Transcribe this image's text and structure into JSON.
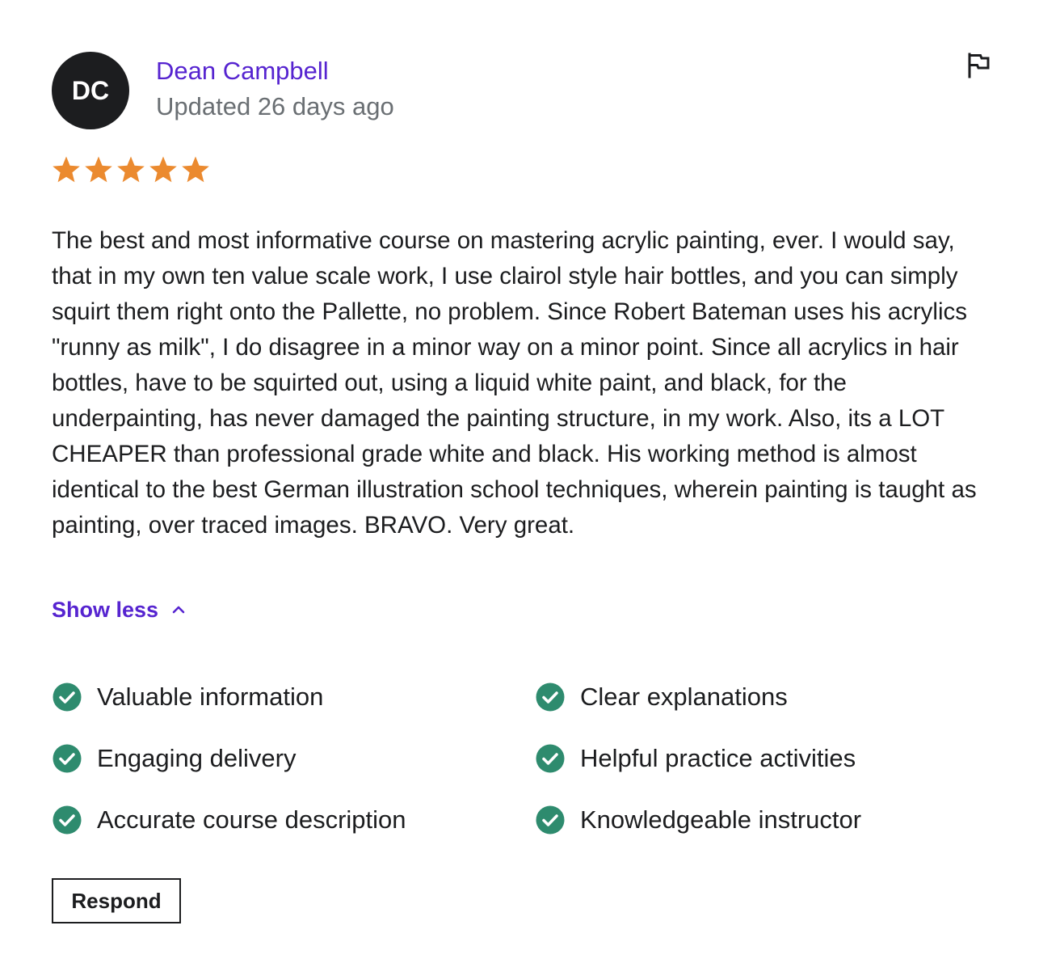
{
  "reviewer": {
    "initials": "DC",
    "name": "Dean Campbell",
    "updated": "Updated 26 days ago"
  },
  "rating": {
    "value": 5,
    "max": 5,
    "star_color": "#eb8a2f"
  },
  "review": {
    "text": "The best and most informative course on mastering acrylic painting, ever. I would say, that in my own ten value scale work, I use clairol style hair bottles, and you can simply squirt them right onto the Pallette, no problem. Since Robert Bateman uses his acrylics \"runny as milk\", I do disagree in a minor way on a minor point. Since all acrylics in hair bottles, have to be squirted out, using a liquid white paint, and black, for the underpainting, has never damaged the painting structure, in my work. Also, its a LOT CHEAPER than professional grade white and black. His working method is almost identical to the best German illustration school techniques, wherein painting is taught as painting, over traced images. BRAVO. Very great."
  },
  "show_less": {
    "label": "Show less",
    "icon": "chevron-up-icon"
  },
  "tags": [
    {
      "label": "Valuable information",
      "icon": "check-circle-icon"
    },
    {
      "label": "Clear explanations",
      "icon": "check-circle-icon"
    },
    {
      "label": "Engaging delivery",
      "icon": "check-circle-icon"
    },
    {
      "label": "Helpful practice activities",
      "icon": "check-circle-icon"
    },
    {
      "label": "Accurate course description",
      "icon": "check-circle-icon"
    },
    {
      "label": "Knowledgeable instructor",
      "icon": "check-circle-icon"
    }
  ],
  "respond": {
    "label": "Respond"
  },
  "colors": {
    "accent": "#5624d0",
    "check": "#2e8b6e",
    "muted": "#6a6f73",
    "text": "#1c1d1f"
  }
}
